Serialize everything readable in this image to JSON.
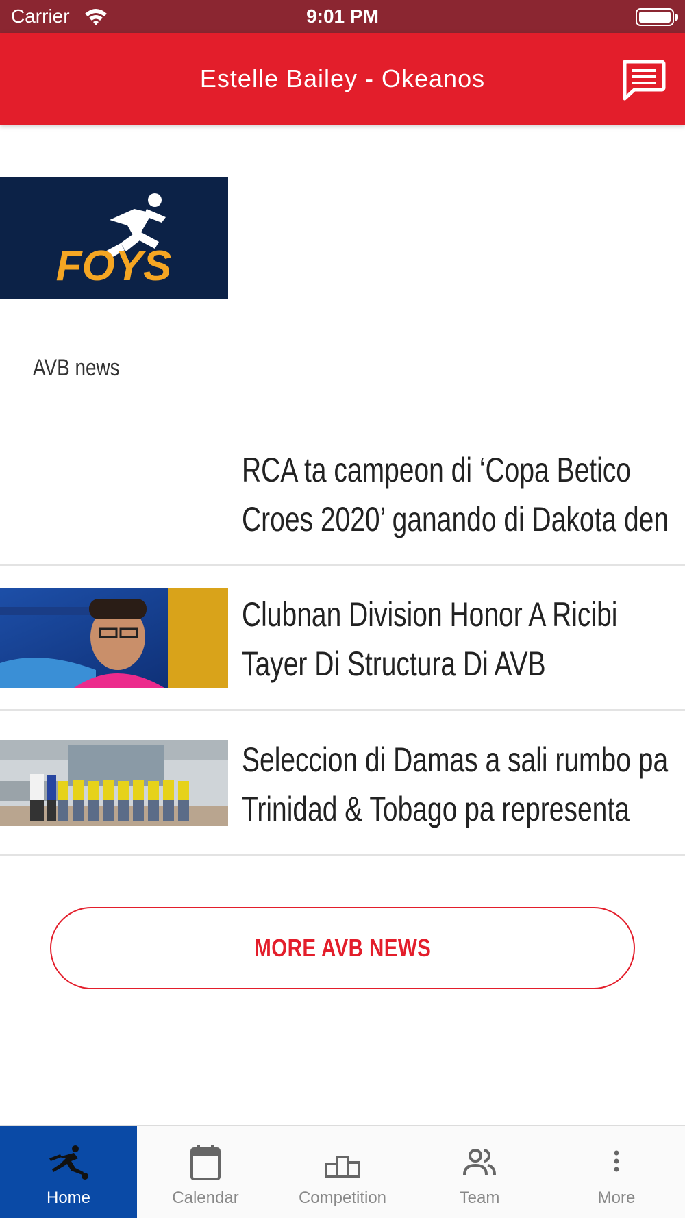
{
  "status_bar": {
    "carrier": "Carrier",
    "time": "9:01 PM"
  },
  "header": {
    "title": "Estelle Bailey - Okeanos",
    "chat_icon": "chat-icon"
  },
  "sponsor": {
    "logo_text": "FOYS",
    "background": "#0c2247",
    "accent": "#f5a623"
  },
  "news": {
    "section_title": "AVB news",
    "items": [
      {
        "line1": "RCA ta campeon di ‘Copa Betico",
        "line2": "Croes 2020’ ganando di Dakota den"
      },
      {
        "line1": "Clubnan Division Honor A Ricibi",
        "line2": "Tayer Di Structura Di AVB"
      },
      {
        "line1": "Seleccion di Damas a sali rumbo pa",
        "line2": "Trinidad & Tobago pa representa"
      }
    ],
    "more_button": "MORE AVB NEWS"
  },
  "tabs": [
    {
      "label": "Home",
      "icon": "soccer-player-icon",
      "active": true
    },
    {
      "label": "Calendar",
      "icon": "calendar-icon",
      "active": false
    },
    {
      "label": "Competition",
      "icon": "podium-icon",
      "active": false
    },
    {
      "label": "Team",
      "icon": "team-icon",
      "active": false
    },
    {
      "label": "More",
      "icon": "more-vertical-icon",
      "active": false
    }
  ],
  "colors": {
    "primary": "#e31e2b",
    "status_bar": "#8b2631",
    "tab_active": "#0a4aa6"
  }
}
